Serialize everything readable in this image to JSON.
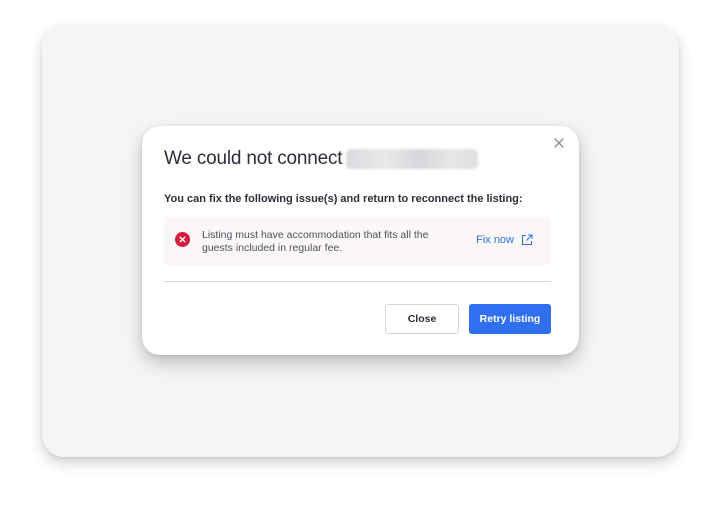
{
  "dialog": {
    "title": "We could not connect",
    "subtitle": "You can fix the following issue(s) and return to reconnect the listing:",
    "issues": [
      {
        "text": "Listing must have accommodation that fits all the guests included in regular fee.",
        "action_label": "Fix now"
      }
    ],
    "buttons": {
      "close_label": "Close",
      "retry_label": "Retry listing"
    }
  },
  "icons": {
    "dismiss": "close-x-icon",
    "issue": "error-circle-icon",
    "fix_link": "external-link-icon"
  },
  "colors": {
    "primary": "#2f6ff0",
    "error": "#d81b3c",
    "link": "#2f6fe4",
    "issue_background": "#fbf7f7"
  }
}
